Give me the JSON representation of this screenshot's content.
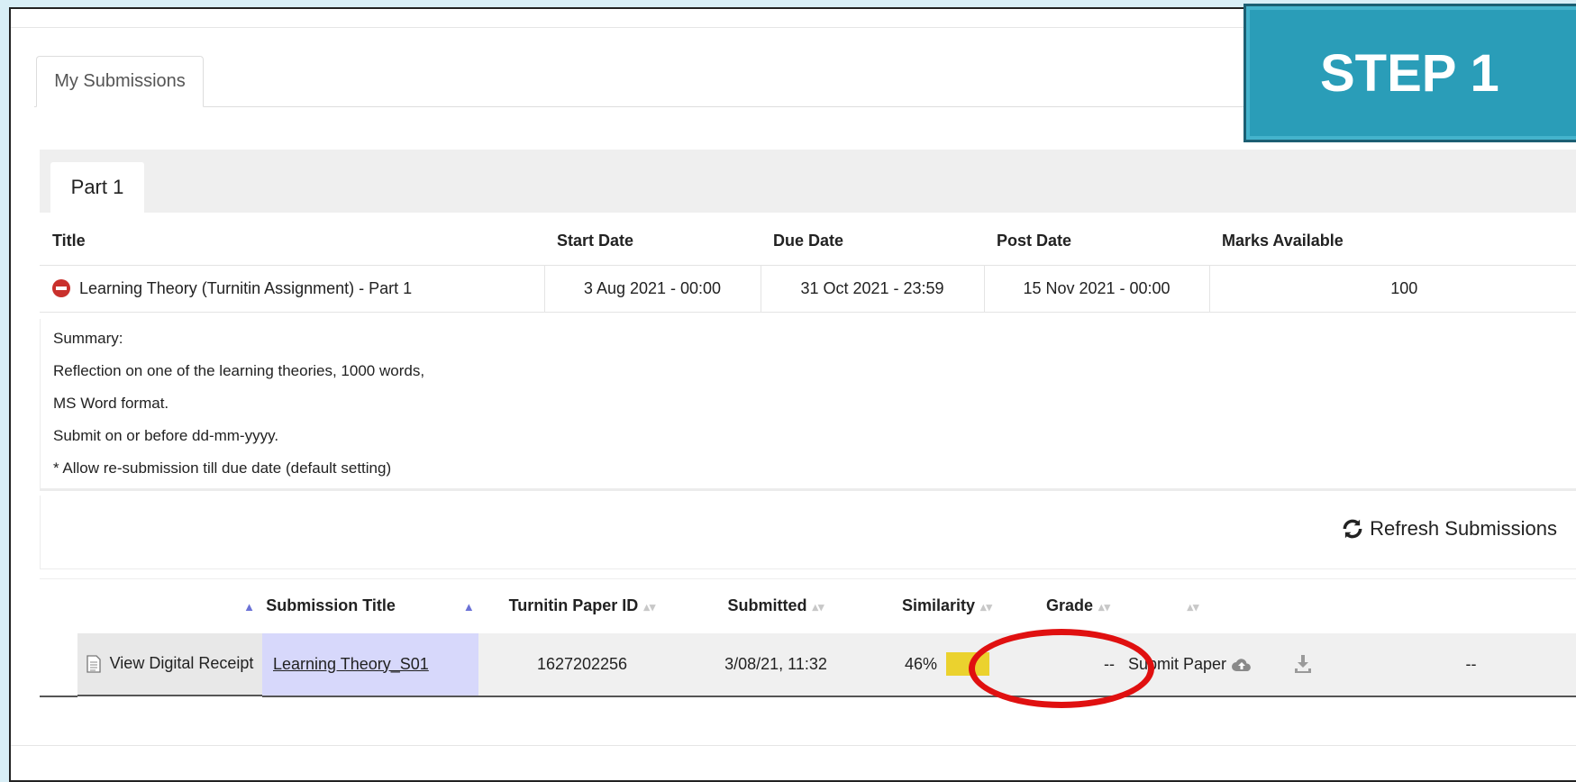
{
  "banner": {
    "step_label": "STEP 1"
  },
  "tabs": {
    "my_submissions": "My Submissions",
    "part": "Part 1"
  },
  "assignment": {
    "headers": [
      "Title",
      "Start Date",
      "Due Date",
      "Post Date",
      "Marks Available"
    ],
    "title": "Learning Theory (Turnitin Assignment) - Part 1",
    "start_date": "3 Aug 2021 - 00:00",
    "due_date": "31 Oct 2021 - 23:59",
    "post_date": "15 Nov 2021 - 00:00",
    "marks": "100"
  },
  "summary": [
    "Summary:",
    "Reflection on one of the learning theories, 1000 words,",
    "MS Word format.",
    "Submit on or before dd-mm-yyyy.",
    "* Allow re-submission till due date (default setting)"
  ],
  "refresh": {
    "label": "Refresh Submissions"
  },
  "submissions": {
    "headers": [
      "Submission Title",
      "Turnitin Paper ID",
      "Submitted",
      "Similarity",
      "Grade"
    ],
    "row": {
      "receipt": "View Digital Receipt",
      "title": "Learning Theory_S01",
      "paper_id": "1627202256",
      "submitted": "3/08/21, 11:32",
      "similarity": "46%",
      "similarity_value": 46,
      "similarity_color": "#ebd22e",
      "grade": "--",
      "submit_label": "Submit Paper",
      "last": "--"
    }
  },
  "colors": {
    "banner": "#2a9db8",
    "highlight_ring": "#e01010",
    "title_cell": "#d7d8fb"
  }
}
